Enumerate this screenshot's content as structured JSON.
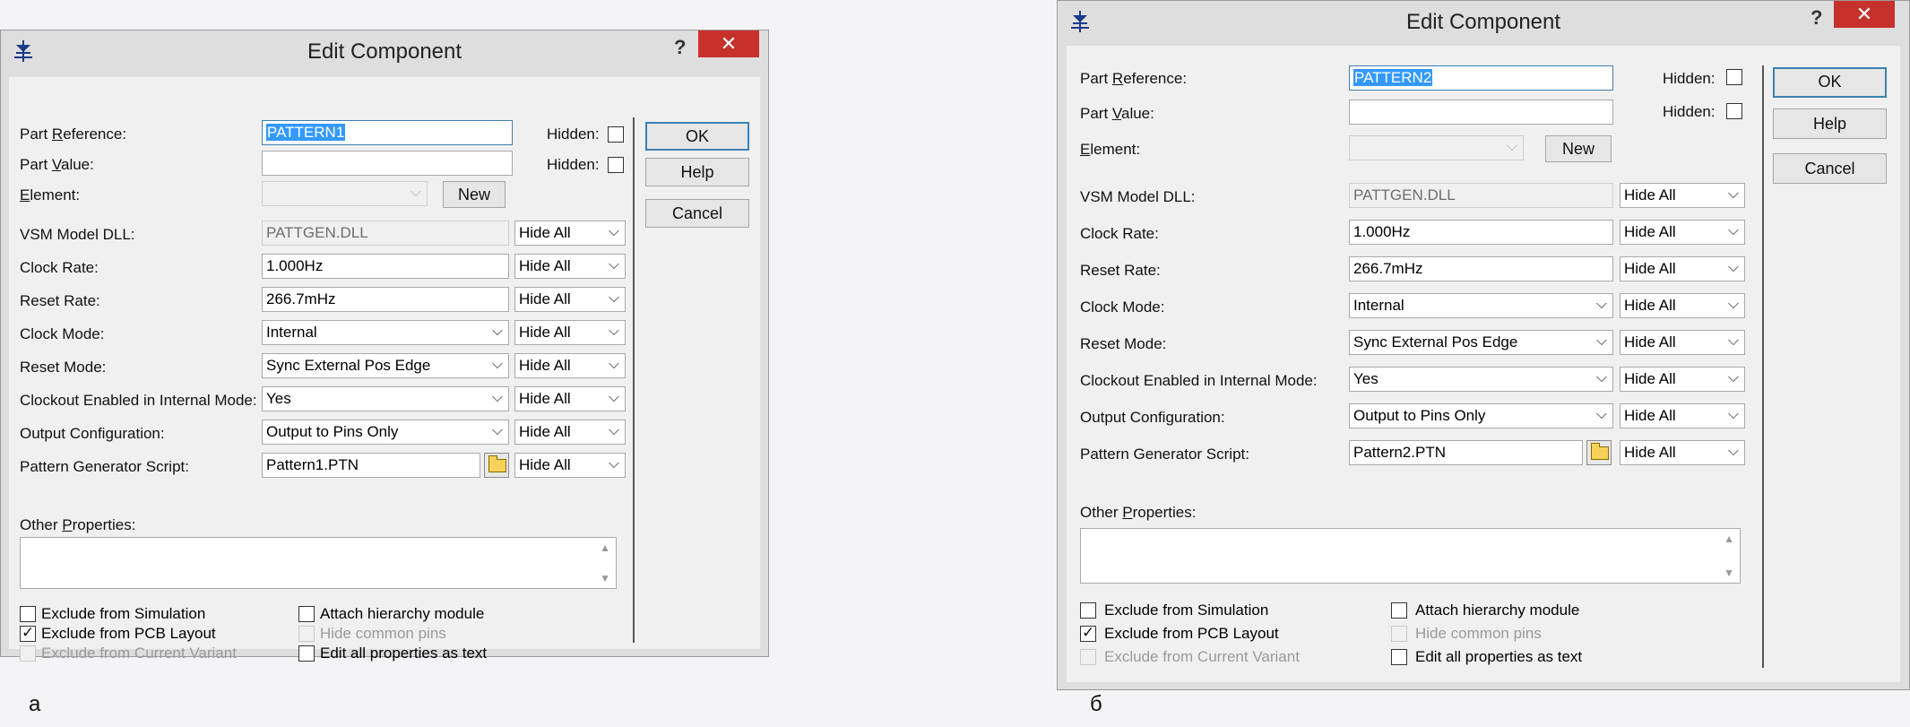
{
  "dialogs": [
    {
      "title": "Edit Component",
      "help_glyph": "?",
      "close_glyph": "✕",
      "part_reference": {
        "label_pre": "Part ",
        "label_u": "R",
        "label_post": "eference:",
        "value": "PATTERN1"
      },
      "part_value": {
        "label_pre": "Part ",
        "label_u": "V",
        "label_post": "alue:",
        "value": ""
      },
      "element": {
        "label_u": "E",
        "label_post": "lement:",
        "value": ""
      },
      "hidden_label": "Hidden:",
      "new_button": "New",
      "ok_button": "OK",
      "help_button": "Help",
      "cancel_button": "Cancel",
      "properties": [
        {
          "label": "VSM Model DLL:",
          "value": "PATTGEN.DLL",
          "kind": "text-disabled",
          "vis": "Hide All"
        },
        {
          "label": "Clock Rate:",
          "value": "1.000Hz",
          "kind": "text",
          "vis": "Hide All"
        },
        {
          "label": "Reset Rate:",
          "value": "266.7mHz",
          "kind": "text",
          "vis": "Hide All"
        },
        {
          "label": "Clock Mode:",
          "value": "Internal",
          "kind": "combo",
          "vis": "Hide All"
        },
        {
          "label": "Reset Mode:",
          "value": "Sync External Pos Edge",
          "kind": "combo",
          "vis": "Hide All"
        },
        {
          "label": "Clockout Enabled in Internal Mode:",
          "value": "Yes",
          "kind": "combo",
          "vis": "Hide All"
        },
        {
          "label": "Output Configuration:",
          "value": "Output to Pins Only",
          "kind": "combo",
          "vis": "Hide All"
        },
        {
          "label": "Pattern Generator Script:",
          "value": "Pattern1.PTN",
          "kind": "file",
          "vis": "Hide All"
        }
      ],
      "other_properties": {
        "label_pre": "Other ",
        "label_u": "P",
        "label_post": "roperties:"
      },
      "checks": {
        "exclude_sim": "Exclude from Simulation",
        "exclude_pcb": "Exclude from PCB Layout",
        "exclude_variant": "Exclude from Current Variant",
        "attach_hier": "Attach hierarchy module",
        "hide_pins": "Hide common pins",
        "edit_text": "Edit all properties as text"
      },
      "caption": "а"
    },
    {
      "title": "Edit Component",
      "help_glyph": "?",
      "close_glyph": "✕",
      "part_reference": {
        "label_pre": "Part ",
        "label_u": "R",
        "label_post": "eference:",
        "value": "PATTERN2"
      },
      "part_value": {
        "label_pre": "Part ",
        "label_u": "V",
        "label_post": "alue:",
        "value": ""
      },
      "element": {
        "label_u": "E",
        "label_post": "lement:",
        "value": ""
      },
      "hidden_label": "Hidden:",
      "new_button": "New",
      "ok_button": "OK",
      "help_button": "Help",
      "cancel_button": "Cancel",
      "properties": [
        {
          "label": "VSM Model DLL:",
          "value": "PATTGEN.DLL",
          "kind": "text-disabled",
          "vis": "Hide All"
        },
        {
          "label": "Clock Rate:",
          "value": "1.000Hz",
          "kind": "text",
          "vis": "Hide All"
        },
        {
          "label": "Reset Rate:",
          "value": "266.7mHz",
          "kind": "text",
          "vis": "Hide All"
        },
        {
          "label": "Clock Mode:",
          "value": "Internal",
          "kind": "combo",
          "vis": "Hide All"
        },
        {
          "label": "Reset Mode:",
          "value": "Sync External Pos Edge",
          "kind": "combo",
          "vis": "Hide All"
        },
        {
          "label": "Clockout Enabled in Internal Mode:",
          "value": "Yes",
          "kind": "combo",
          "vis": "Hide All"
        },
        {
          "label": "Output Configuration:",
          "value": "Output to Pins Only",
          "kind": "combo",
          "vis": "Hide All"
        },
        {
          "label": "Pattern Generator Script:",
          "value": "Pattern2.PTN",
          "kind": "file",
          "vis": "Hide All"
        }
      ],
      "other_properties": {
        "label_pre": "Other ",
        "label_u": "P",
        "label_post": "roperties:"
      },
      "checks": {
        "exclude_sim": "Exclude from Simulation",
        "exclude_pcb": "Exclude from PCB Layout",
        "exclude_variant": "Exclude from Current Variant",
        "attach_hier": "Attach hierarchy module",
        "hide_pins": "Hide common pins",
        "edit_text": "Edit all properties as text"
      },
      "caption": "б"
    }
  ]
}
